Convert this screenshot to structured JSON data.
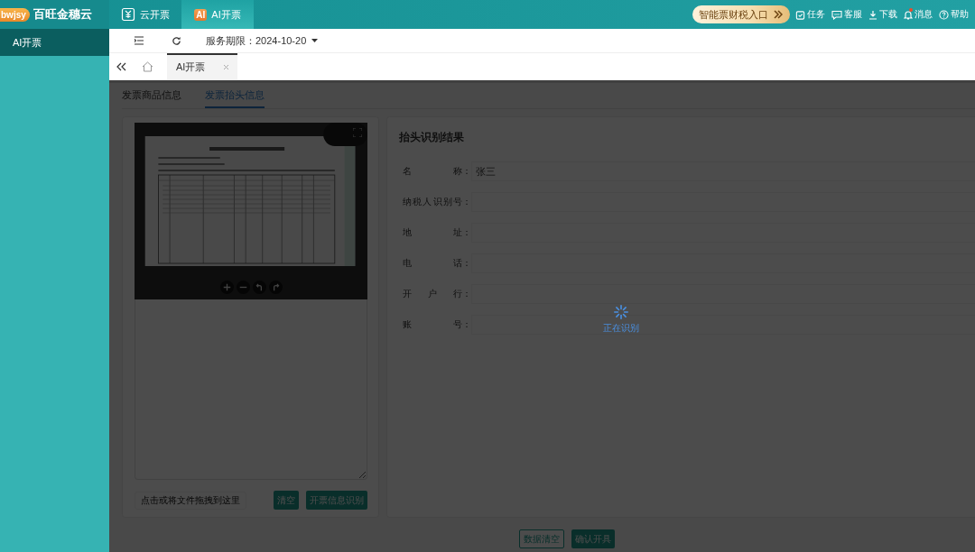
{
  "brand": {
    "logo_text": "bwjsy",
    "name": "百旺金穗云"
  },
  "top_tabs": [
    {
      "label": "云开票",
      "selected": false
    },
    {
      "label": "AI开票",
      "selected": true,
      "badge": "AI"
    }
  ],
  "promo_button": {
    "label": "智能票财税入口"
  },
  "header_links": [
    {
      "label": "任务",
      "unread": false
    },
    {
      "label": "客服",
      "unread": false
    },
    {
      "label": "下载",
      "unread": false
    },
    {
      "label": "消息",
      "unread": true
    },
    {
      "label": "帮助",
      "unread": false
    }
  ],
  "sidebar": {
    "items": [
      {
        "label": "AI开票",
        "selected": true
      }
    ]
  },
  "toolbar": {
    "service_period": "服务期限：2024-10-20"
  },
  "page_tabs": [
    {
      "label": "AI开票",
      "selected": true,
      "closable": true
    }
  ],
  "sub_tabs": [
    {
      "label": "发票商品信息",
      "selected": false
    },
    {
      "label": "发票抬头信息",
      "selected": true
    }
  ],
  "upload": {
    "drop_hint": "点击或将文件拖拽到这里",
    "buttons": [
      {
        "label": "清空"
      },
      {
        "label": "开票信息识别"
      }
    ]
  },
  "result": {
    "title": "抬头识别结果",
    "fields": [
      {
        "label": "名称",
        "colon": "：",
        "value": "张三"
      },
      {
        "label": "纳税人识别号",
        "colon": "："
      },
      {
        "label": "地址",
        "colon": "："
      },
      {
        "label": "电话",
        "colon": "："
      },
      {
        "label": "开户行",
        "colon": "："
      },
      {
        "label": "账号",
        "colon": "："
      }
    ]
  },
  "footer_buttons": [
    {
      "label": "数据清空",
      "kind": "outline"
    },
    {
      "label": "确认开具",
      "kind": "primary"
    }
  ],
  "loading": {
    "active": true,
    "text": "正在识别"
  }
}
